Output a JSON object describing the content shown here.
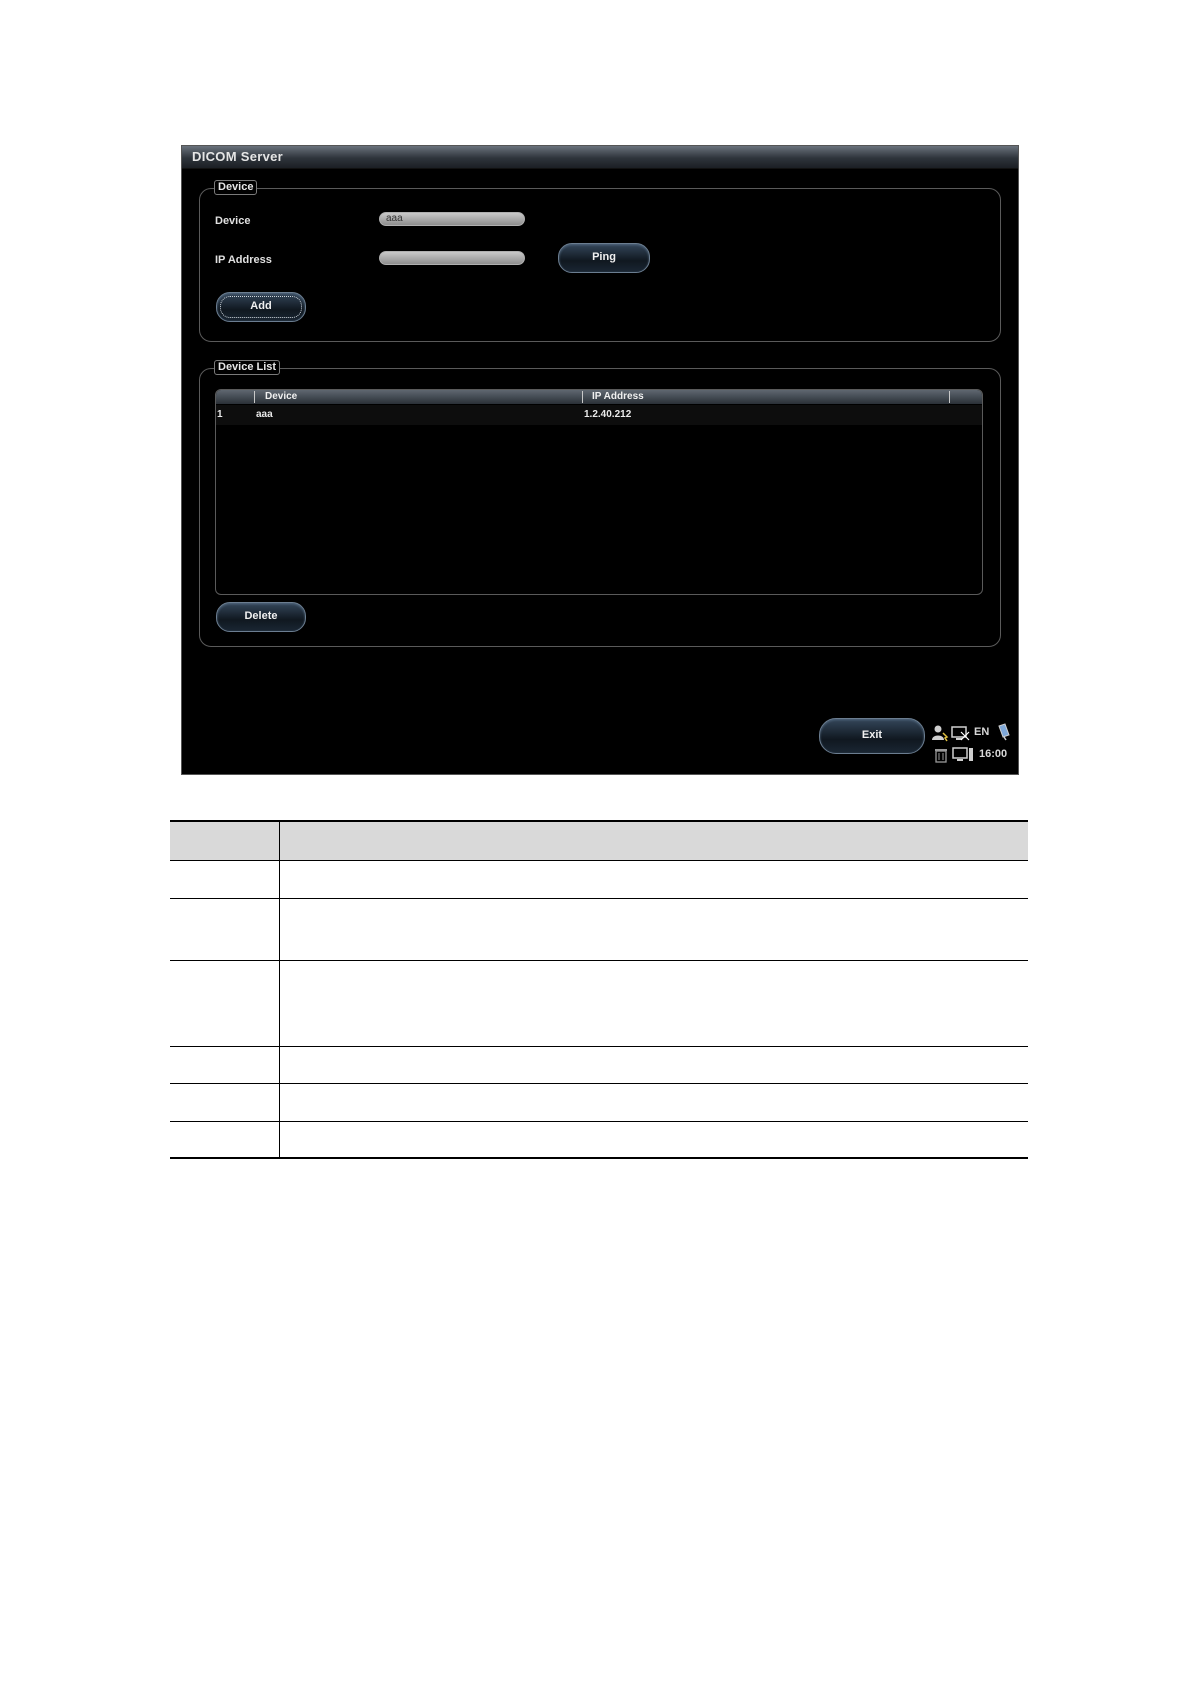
{
  "window": {
    "title": "DICOM Server"
  },
  "device_group": {
    "legend": "Device",
    "device_label": "Device",
    "device_value": "aaa",
    "ip_label": "IP Address",
    "ip_value": "",
    "ping_label": "Ping",
    "add_label": "Add"
  },
  "device_list": {
    "legend": "Device List",
    "columns": [
      "Device",
      "IP Address"
    ],
    "rows": [
      {
        "index": "1",
        "device": "aaa",
        "ip": "1.2.40.212"
      }
    ],
    "delete_label": "Delete"
  },
  "footer": {
    "exit_label": "Exit",
    "language": "EN",
    "time": "16:00",
    "icons": [
      "user-icon",
      "network-icon",
      "usb-icon",
      "trash-icon",
      "monitor-icon"
    ]
  }
}
